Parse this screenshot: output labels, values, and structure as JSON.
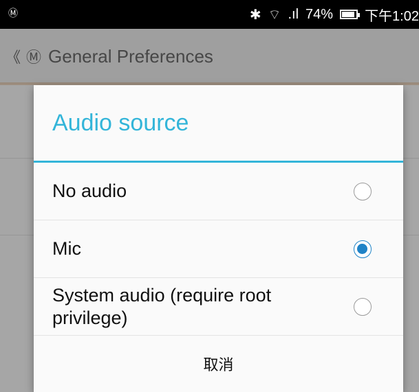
{
  "status_bar": {
    "left_icon": "Ⓜ",
    "battery": "74%",
    "time": "下午1:02"
  },
  "app_bar": {
    "back_glyph": "《",
    "icon": "Ⓜ",
    "title": "General Preferences"
  },
  "dialog": {
    "title": "Audio source",
    "options": [
      {
        "label": "No audio",
        "checked": false
      },
      {
        "label": "Mic",
        "checked": true
      },
      {
        "label": "System audio (require root privilege)",
        "checked": false
      }
    ],
    "cancel_label": "取消"
  }
}
